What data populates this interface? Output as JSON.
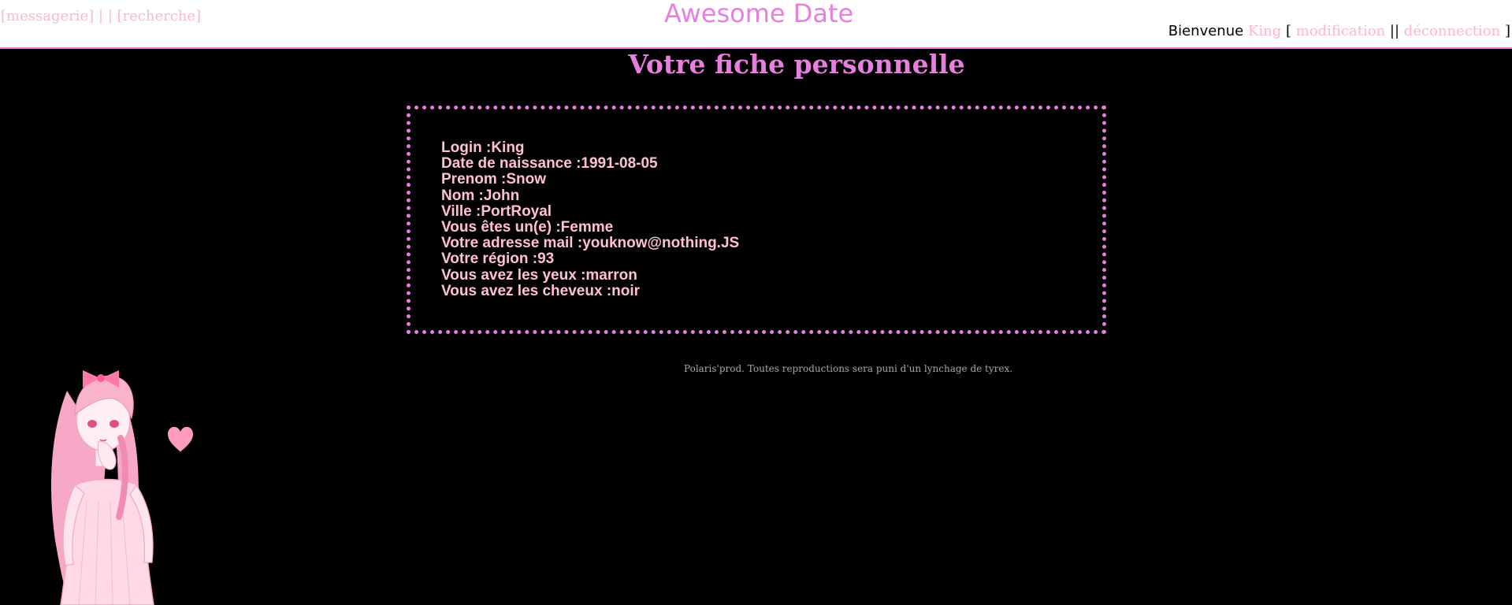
{
  "header": {
    "nav_left": {
      "messagerie": "[messagerie]",
      "separator": "| |",
      "recherche": "[recherche]"
    },
    "site_title": "Awesome Date",
    "nav_right": {
      "welcome": "Bienvenue",
      "username": "King",
      "open_bracket": "[",
      "modification": "modification",
      "separator": "||",
      "deconnection": "déconnection",
      "close_bracket": "]"
    }
  },
  "main": {
    "heading": "Votre fiche personnelle",
    "profile_fields": [
      {
        "label": "Login :",
        "value": "King"
      },
      {
        "label": "Date de naissance :",
        "value": "1991-08-05"
      },
      {
        "label": "Prenom :",
        "value": "Snow"
      },
      {
        "label": "Nom :",
        "value": "John"
      },
      {
        "label": "Ville :",
        "value": "PortRoyal"
      },
      {
        "label": "Vous êtes un(e) :",
        "value": "Femme"
      },
      {
        "label": "Votre adresse mail :",
        "value": "youknow@nothing.JS"
      },
      {
        "label": "Votre région :",
        "value": "93"
      },
      {
        "label": "Vous avez les yeux :",
        "value": "marron"
      },
      {
        "label": "Vous avez les cheveux :",
        "value": "noir"
      }
    ]
  },
  "footer": {
    "note": "Polaris'prod. Toutes reproductions sera puni d'un lynchage de tyrex."
  },
  "colors": {
    "accent": "#e87ee0",
    "link_pink": "#ffb6c8",
    "profile_text": "#ffc0d4",
    "background": "#000000",
    "header_background": "#ffffff"
  },
  "icons": {
    "mascot": "anime-girl-illustration",
    "heart": "heart-icon"
  }
}
